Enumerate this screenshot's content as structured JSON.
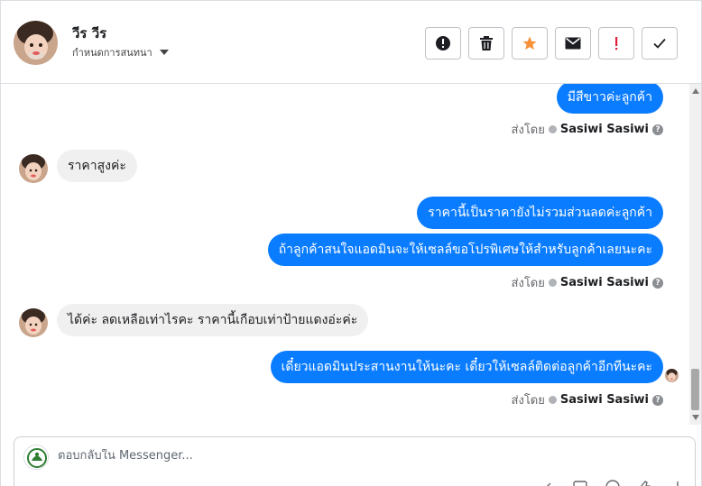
{
  "header": {
    "contact_name": "วีร วีร",
    "assign_label": "กำหนดการสนทนา",
    "actions": [
      {
        "name": "spam-button",
        "icon": "alert-circle-icon"
      },
      {
        "name": "delete-button",
        "icon": "trash-icon"
      },
      {
        "name": "star-button",
        "icon": "star-icon",
        "color": "#f7923b"
      },
      {
        "name": "mark-unread-button",
        "icon": "envelope-icon"
      },
      {
        "name": "follow-up-button",
        "icon": "exclamation-icon",
        "color": "#e41e3f"
      },
      {
        "name": "mark-done-button",
        "icon": "check-icon"
      }
    ]
  },
  "thread": {
    "sent_by_label": "ส่งโดย",
    "agent_name": "Sasiwi Sasiwi",
    "messages": {
      "m1": "มีสีขาวค่ะลูกค้า",
      "m2": "ราคาสูงค่ะ",
      "m3": "ราคานี้เป็นราคายังไม่รวมส่วนลดค่ะลูกค้า",
      "m4": "ถ้าลูกค้าสนใจแอดมินจะให้เซลล์ขอโปรพิเศษให้สำหรับลูกค้าเลยนะคะ",
      "m5": "ได้ค่ะ ลดเหลือเท่าไรคะ ราคานี้เกือบเท่าป้ายแดงอ่ะค่ะ",
      "m6": "เดี๋ยวแอดมินประสานงานให้นะคะ เดี๋ยวให้เซลล์ติดต่อลูกค้าอีกทีนะคะ"
    }
  },
  "composer": {
    "placeholder": "ตอบกลับใน Messenger..."
  },
  "colors": {
    "outgoing_bubble": "#0a7cff",
    "incoming_bubble": "#f0f0f0"
  }
}
